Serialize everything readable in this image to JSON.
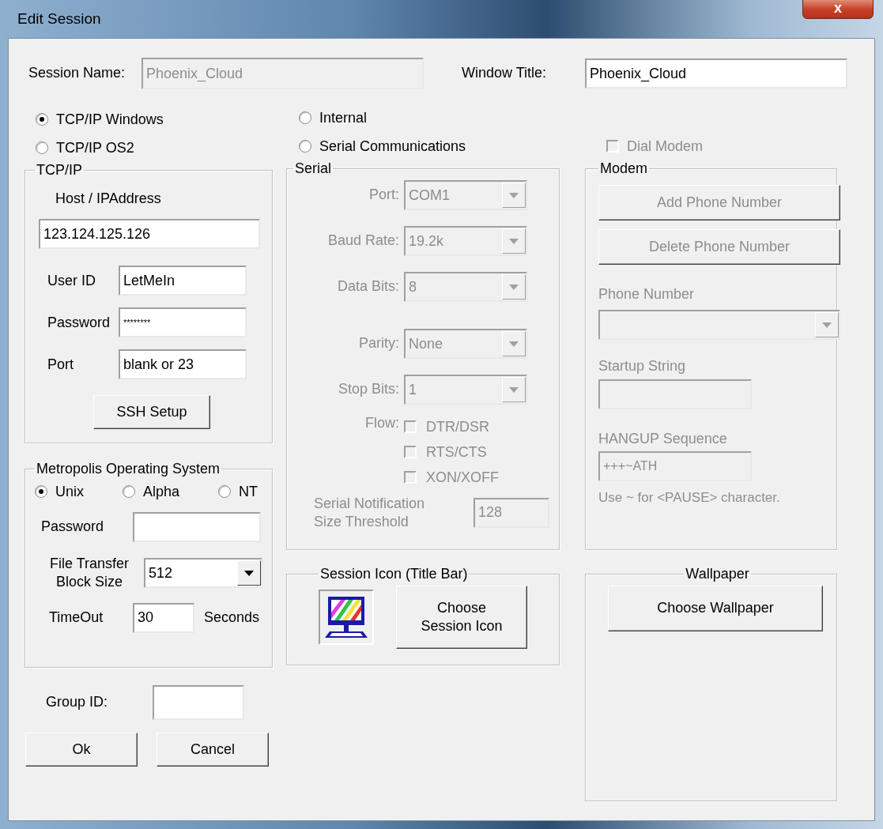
{
  "window": {
    "title": "Edit Session",
    "close": "x"
  },
  "session_name": {
    "label": "Session Name:",
    "value": "Phoenix_Cloud",
    "disabled": true
  },
  "window_title": {
    "label": "Window Title:",
    "value": "Phoenix_Cloud"
  },
  "connection_types": [
    {
      "label": "TCP/IP Windows",
      "selected": true
    },
    {
      "label": "TCP/IP OS2",
      "selected": false
    },
    {
      "label": "Internal",
      "selected": false
    },
    {
      "label": "Serial Communications",
      "selected": false
    }
  ],
  "dial_modem": {
    "label": "Dial Modem",
    "checked": false,
    "disabled": true
  },
  "tcpip": {
    "title": "TCP/IP",
    "host_label": "Host / IPAddress",
    "host": "123.124.125.126",
    "fields": [
      {
        "label": "User ID",
        "value": "LetMeIn"
      },
      {
        "label": "Password",
        "value": "********"
      },
      {
        "label": "Port",
        "value": "blank or 23"
      }
    ],
    "ssh_button": "SSH Setup"
  },
  "metropolis": {
    "title": "Metropolis Operating System",
    "os": [
      {
        "label": "Unix",
        "selected": true
      },
      {
        "label": "Alpha",
        "selected": false
      },
      {
        "label": "NT",
        "selected": false
      }
    ],
    "password_label": "Password",
    "block_size_label": "File Transfer\nBlock Size",
    "block_size": "512",
    "timeout_label": "TimeOut",
    "timeout": "30",
    "timeout_unit": "Seconds"
  },
  "group_id": {
    "label": "Group ID:"
  },
  "buttons": [
    "Ok",
    "Cancel"
  ],
  "serial": {
    "title": "Serial",
    "disabled": true,
    "dropdowns": [
      {
        "label": "Port:",
        "value": "COM1"
      },
      {
        "label": "Baud Rate:",
        "value": "19.2k"
      },
      {
        "label": "Data Bits:",
        "value": "8"
      },
      {
        "label": "Parity:",
        "value": "None"
      },
      {
        "label": "Stop Bits:",
        "value": "1"
      }
    ],
    "flow_label": "Flow:",
    "flow_options": [
      {
        "label": "DTR/DSR",
        "checked": false
      },
      {
        "label": "RTS/CTS",
        "checked": false
      },
      {
        "label": "XON/XOFF",
        "checked": false
      }
    ],
    "threshold_label": "Serial Notification\nSize Threshold",
    "threshold": "128"
  },
  "session_icon": {
    "title": "Session Icon (Title Bar)",
    "button": "Choose\nSession Icon"
  },
  "modem": {
    "title": "Modem",
    "disabled": true,
    "buttons": [
      "Add Phone Number",
      "Delete Phone Number"
    ],
    "phone_label": "Phone Number",
    "startup_label": "Startup String",
    "hangup_label": "HANGUP Sequence",
    "hangup": "+++~ATH",
    "note": "Use ~ for <PAUSE> character."
  },
  "wallpaper": {
    "title": "Wallpaper",
    "button": "Choose Wallpaper"
  }
}
